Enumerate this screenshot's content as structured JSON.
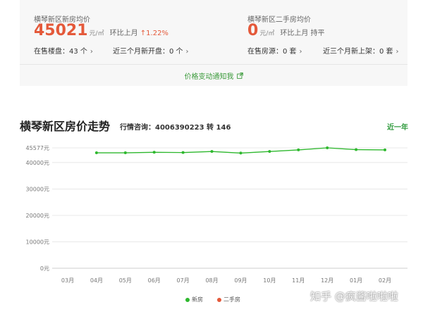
{
  "summary": {
    "new_home": {
      "label": "横琴新区新房均价",
      "price": "45021",
      "unit": "元/㎡",
      "mom_label": "环比上月",
      "mom_value": "↑1.22%",
      "on_sale": "在售楼盘：43 个",
      "new_openings": "近三个月新开盘：0 个"
    },
    "second_hand": {
      "label": "横琴新区二手房均价",
      "price": "0",
      "unit": "元/㎡",
      "mom_label": "环比上月",
      "mom_value": "持平",
      "on_sale": "在售房源：0 套",
      "new_listings": "近三个月新上架：0 套"
    },
    "notify_link": "价格变动通知我"
  },
  "trend": {
    "title": "横琴新区房价走势",
    "consult": "行情咨询：4006390223 转 146",
    "period_link": "近一年"
  },
  "colors": {
    "new": "#2eb82e",
    "second_hand": "#e4593a",
    "accent_green": "#2e9a3c"
  },
  "icons": {
    "chevron": "chevron-right-icon",
    "external": "external-link-icon"
  },
  "chart_data": {
    "type": "line",
    "categories": [
      "03月",
      "04月",
      "05月",
      "06月",
      "07月",
      "08月",
      "09月",
      "10月",
      "11月",
      "12月",
      "01月",
      "02月"
    ],
    "y_ticks": [
      "0元",
      "10000元",
      "20000元",
      "30000元",
      "40000元",
      "45577元"
    ],
    "y_tick_values": [
      0,
      10000,
      20000,
      30000,
      40000,
      45577
    ],
    "ylim": [
      0,
      45577
    ],
    "series": [
      {
        "name": "新房",
        "values": [
          null,
          43700,
          43700,
          43900,
          43800,
          44200,
          43600,
          44200,
          44800,
          45577,
          44900,
          44800
        ]
      },
      {
        "name": "二手房",
        "values": []
      }
    ],
    "grid": true,
    "legend_position": "bottom"
  },
  "watermark": "知乎 @疯酱啦啦啦"
}
